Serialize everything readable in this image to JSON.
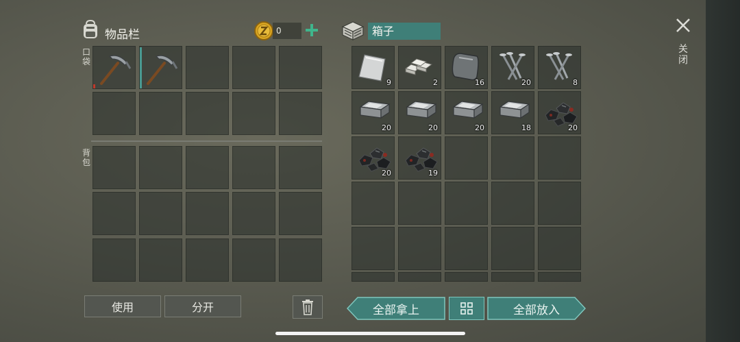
{
  "inventory": {
    "title": "物品栏",
    "pocket_label": "口袋",
    "backpack_label": "背包",
    "coin_count": "0"
  },
  "pocket_items": [
    {
      "slot": 0,
      "icon": "pickaxe-icon",
      "name": "pickaxe",
      "durability_color": "#c0392b"
    },
    {
      "slot": 1,
      "icon": "pickaxe-icon",
      "name": "pickaxe",
      "durability_color": "#4a9a92"
    }
  ],
  "box": {
    "title": "箱子",
    "items": [
      {
        "icon": "metal-sheet-icon",
        "qty": "9"
      },
      {
        "icon": "metal-bars-icon",
        "qty": "2"
      },
      {
        "icon": "iron-plate-icon",
        "qty": "16"
      },
      {
        "icon": "nails-icon",
        "qty": "20"
      },
      {
        "icon": "nails-icon",
        "qty": "8"
      },
      {
        "icon": "iron-ingot-icon",
        "qty": "20"
      },
      {
        "icon": "iron-ingot-icon",
        "qty": "20"
      },
      {
        "icon": "iron-ingot-icon",
        "qty": "20"
      },
      {
        "icon": "iron-ingot-icon",
        "qty": "18"
      },
      {
        "icon": "coal-icon",
        "qty": "20"
      },
      {
        "icon": "coal-icon",
        "qty": "20"
      },
      {
        "icon": "coal-icon",
        "qty": "19"
      }
    ]
  },
  "buttons": {
    "use": "使用",
    "split": "分开",
    "take_all": "全部拿上",
    "put_all": "全部放入",
    "close": "关闭"
  },
  "colors": {
    "teal": "#3f7f78",
    "teal_border": "#7fc6bd",
    "coin_gold": "#d9a520",
    "plus_green": "#3fb58c"
  }
}
